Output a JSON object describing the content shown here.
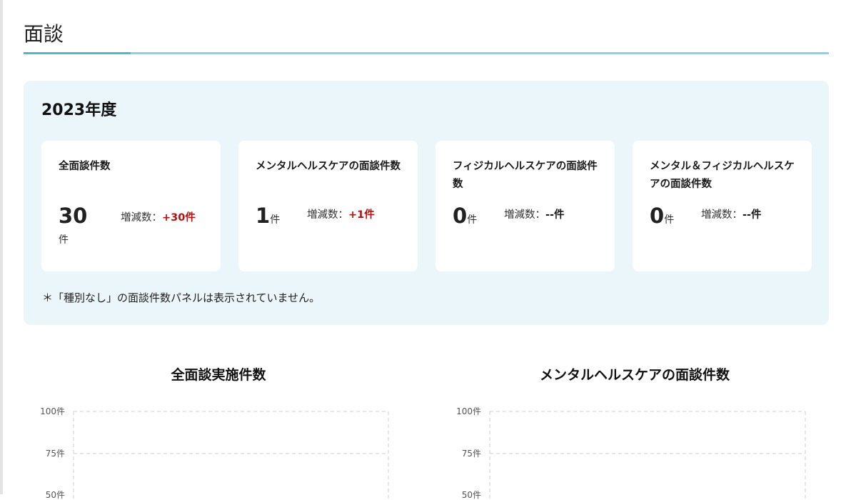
{
  "page": {
    "title": "面談"
  },
  "year_panel": {
    "title": "2023年度",
    "note": "＊「種別なし」の面談件数パネルは表示されていません。",
    "cards": [
      {
        "label": "全面談件数",
        "count": "30",
        "unit": "件",
        "delta_label": "増減数：",
        "delta_value": "+30件"
      },
      {
        "label": "メンタルヘルスケアの面談件数",
        "count": "1",
        "unit": "件",
        "delta_label": "増減数：",
        "delta_value": "+1件"
      },
      {
        "label": "フィジカルヘルスケアの面談件数",
        "count": "0",
        "unit": "件",
        "delta_label": "増減数：",
        "delta_value": "--件"
      },
      {
        "label": "メンタル＆フィジカルヘルスケアの面談件数",
        "count": "0",
        "unit": "件",
        "delta_label": "増減数：",
        "delta_value": "--件"
      }
    ]
  },
  "charts": [
    {
      "title": "全面談実施件数",
      "y_ticks": [
        "100件",
        "75件",
        "50件"
      ]
    },
    {
      "title": "メンタルヘルスケアの面談件数",
      "y_ticks": [
        "100件",
        "75件",
        "50件"
      ]
    }
  ],
  "colors": {
    "accent": "#4eb8cf",
    "rule": "#86d4e6",
    "panel_bg": "#eaf6f9",
    "positive_delta": "#b3120e"
  }
}
